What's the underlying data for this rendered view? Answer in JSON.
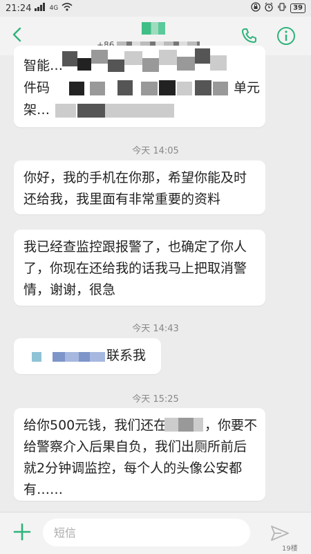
{
  "status_bar": {
    "time": "21:24",
    "network": "4G",
    "battery": "39"
  },
  "header": {
    "contact_number_prefix": "+86"
  },
  "messages": [
    {
      "lines": [
        "智能…",
        "件码",
        "架…"
      ],
      "unit_text": "单元"
    },
    {
      "timestamp": "今天 14:05"
    },
    {
      "lines": [
        "你好，我的手机在你那，希望你能及时",
        "还给我，我里面有非常重要的资料"
      ]
    },
    {
      "lines": [
        "我已经查监控跟报警了，也确定了你人",
        "了，你现在还给我的话我马上把取消警",
        "情，谢谢，很急"
      ]
    },
    {
      "timestamp": "今天 14:43"
    },
    {
      "text": "联系我"
    },
    {
      "timestamp": "今天 15:25"
    },
    {
      "lines": [
        "给你500元钱，我们还在",
        "，你要不",
        "给警察介入后果自负，我们出厕所前后",
        "就2分钟调监控，每个人的头像公安都",
        "有……"
      ]
    }
  ],
  "composer": {
    "placeholder": "短信"
  },
  "watermark": "19楼",
  "colors": {
    "accent": "#2eb37a",
    "bubble": "#ffffff",
    "background": "#ececec"
  },
  "icons": {
    "back": "back-arrow-icon",
    "phone": "phone-icon",
    "info": "info-icon",
    "add": "add-icon",
    "send": "send-icon"
  }
}
